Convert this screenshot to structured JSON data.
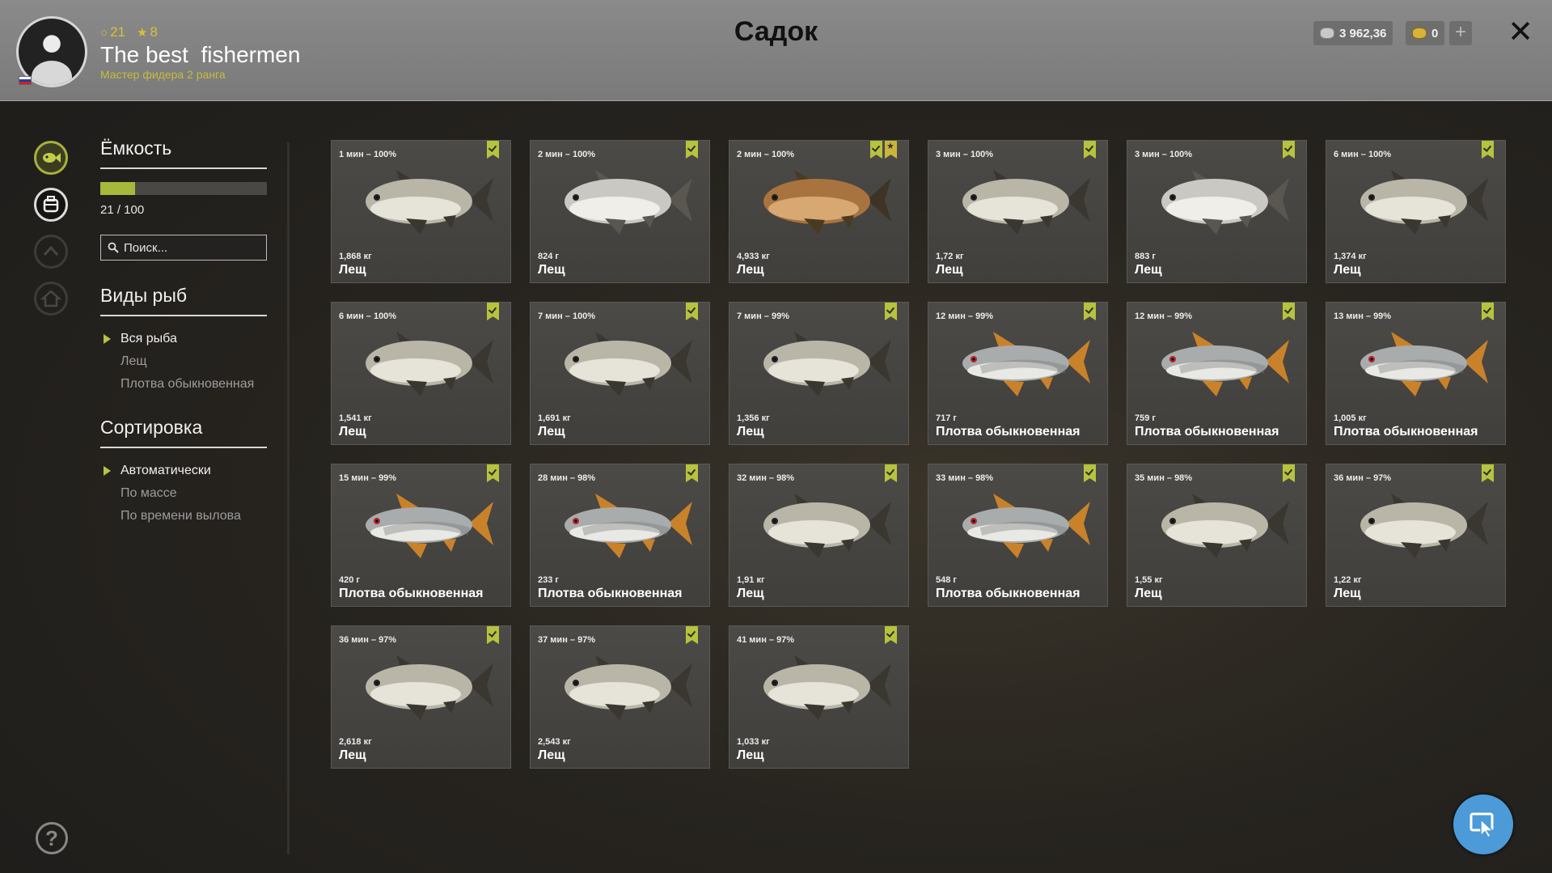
{
  "header": {
    "title": "Садок",
    "player": {
      "name": "The best  fishermen",
      "rank": "Мастер фидера 2 ранга",
      "level": "21",
      "stars": "8"
    },
    "silver": "3 962,36",
    "gold": "0"
  },
  "sidebar": {
    "capacity_title": "Ёмкость",
    "capacity_fraction": 0.21,
    "capacity_text": "21 / 100",
    "search_placeholder": "Поиск...",
    "species_title": "Виды рыб",
    "species": [
      "Вся рыба",
      "Лещ",
      "Плотва обыкновенная"
    ],
    "sort_title": "Сортировка",
    "sort": [
      "Автоматически",
      "По массе",
      "По времени вылова"
    ]
  },
  "catch": [
    {
      "time": "1 мин – 100%",
      "weight": "1,868 кг",
      "name": "Лещ",
      "kind": "bream",
      "star": false
    },
    {
      "time": "2 мин – 100%",
      "weight": "824 г",
      "name": "Лещ",
      "kind": "bream-silver",
      "star": false
    },
    {
      "time": "2 мин – 100%",
      "weight": "4,933 кг",
      "name": "Лещ",
      "kind": "bream-bronze",
      "star": true
    },
    {
      "time": "3 мин – 100%",
      "weight": "1,72 кг",
      "name": "Лещ",
      "kind": "bream",
      "star": false
    },
    {
      "time": "3 мин – 100%",
      "weight": "883 г",
      "name": "Лещ",
      "kind": "bream-silver",
      "star": false
    },
    {
      "time": "6 мин – 100%",
      "weight": "1,374 кг",
      "name": "Лещ",
      "kind": "bream",
      "star": false
    },
    {
      "time": "6 мин – 100%",
      "weight": "1,541 кг",
      "name": "Лещ",
      "kind": "bream",
      "star": false
    },
    {
      "time": "7 мин – 100%",
      "weight": "1,691 кг",
      "name": "Лещ",
      "kind": "bream",
      "star": false
    },
    {
      "time": "7 мин – 99%",
      "weight": "1,356 кг",
      "name": "Лещ",
      "kind": "bream",
      "star": false
    },
    {
      "time": "12 мин – 99%",
      "weight": "717 г",
      "name": "Плотва обыкновенная",
      "kind": "roach",
      "star": false
    },
    {
      "time": "12 мин – 99%",
      "weight": "759 г",
      "name": "Плотва обыкновенная",
      "kind": "roach",
      "star": false
    },
    {
      "time": "13 мин – 99%",
      "weight": "1,005 кг",
      "name": "Плотва обыкновенная",
      "kind": "roach",
      "star": false
    },
    {
      "time": "15 мин – 99%",
      "weight": "420 г",
      "name": "Плотва обыкновенная",
      "kind": "roach",
      "star": false
    },
    {
      "time": "28 мин – 98%",
      "weight": "233 г",
      "name": "Плотва обыкновенная",
      "kind": "roach",
      "star": false
    },
    {
      "time": "32 мин – 98%",
      "weight": "1,91 кг",
      "name": "Лещ",
      "kind": "bream",
      "star": false
    },
    {
      "time": "33 мин – 98%",
      "weight": "548 г",
      "name": "Плотва обыкновенная",
      "kind": "roach",
      "star": false
    },
    {
      "time": "35 мин – 98%",
      "weight": "1,55 кг",
      "name": "Лещ",
      "kind": "bream",
      "star": false
    },
    {
      "time": "36 мин – 97%",
      "weight": "1,22 кг",
      "name": "Лещ",
      "kind": "bream",
      "star": false
    },
    {
      "time": "36 мин – 97%",
      "weight": "2,618 кг",
      "name": "Лещ",
      "kind": "bream",
      "star": false
    },
    {
      "time": "37 мин – 97%",
      "weight": "2,543 кг",
      "name": "Лещ",
      "kind": "bream",
      "star": false
    },
    {
      "time": "41 мин – 97%",
      "weight": "1,033 кг",
      "name": "Лещ",
      "kind": "bream",
      "star": false
    }
  ],
  "colors": {
    "accent": "#b7c33c",
    "header_bg": "#8a8a8a",
    "rank_text": "#c9bb3c",
    "cursor_button": "#4c9ad8"
  },
  "icons": {
    "rail": [
      "fish-icon",
      "keepnet-icon",
      "upgrade-icon",
      "home-icon"
    ],
    "help": "help-icon",
    "close": "close-icon",
    "cursor": "cursor-mode-icon"
  }
}
